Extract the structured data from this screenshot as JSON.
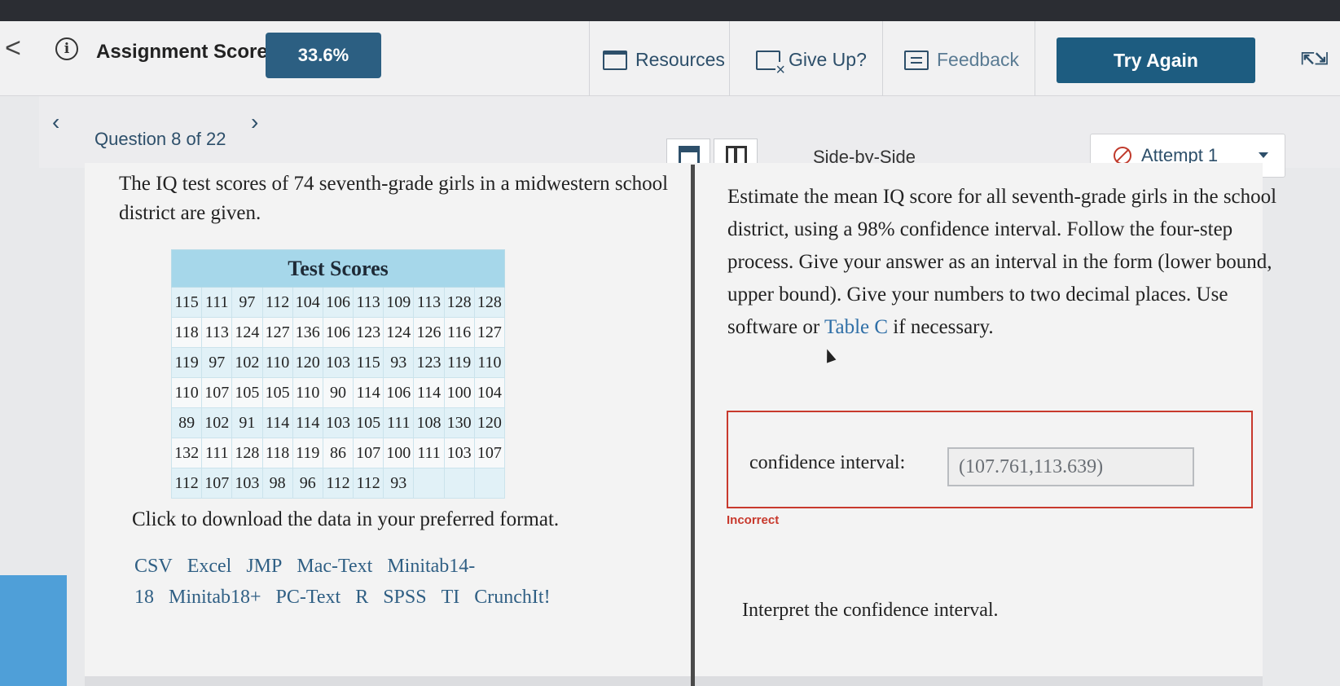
{
  "topbar": {
    "back": "<",
    "score_label": "Assignment Score:",
    "score_value": "33.6%",
    "resources": "Resources",
    "give_up": "Give Up?",
    "feedback": "Feedback",
    "try_again": "Try Again"
  },
  "subbar": {
    "question_label": "Question 8 of 22",
    "layout_label": "Side-by-Side",
    "attempt": "Attempt 1"
  },
  "left": {
    "prompt": "The IQ test scores of 74 seventh-grade girls in a midwestern school district are given.",
    "table_title": "Test Scores",
    "rows": [
      [
        "115",
        "111",
        "97",
        "112",
        "104",
        "106",
        "113",
        "109",
        "113",
        "128",
        "128"
      ],
      [
        "118",
        "113",
        "124",
        "127",
        "136",
        "106",
        "123",
        "124",
        "126",
        "116",
        "127"
      ],
      [
        "119",
        "97",
        "102",
        "110",
        "120",
        "103",
        "115",
        "93",
        "123",
        "119",
        "110"
      ],
      [
        "110",
        "107",
        "105",
        "105",
        "110",
        "90",
        "114",
        "106",
        "114",
        "100",
        "104"
      ],
      [
        "89",
        "102",
        "91",
        "114",
        "114",
        "103",
        "105",
        "111",
        "108",
        "130",
        "120"
      ],
      [
        "132",
        "111",
        "128",
        "118",
        "119",
        "86",
        "107",
        "100",
        "111",
        "103",
        "107"
      ],
      [
        "112",
        "107",
        "103",
        "98",
        "96",
        "112",
        "112",
        "93",
        "",
        "",
        ""
      ]
    ],
    "download_label": "Click to download the data in your preferred format.",
    "formats": [
      "CSV",
      "Excel",
      "JMP",
      "Mac-Text",
      "Minitab14-18",
      "Minitab18+",
      "PC-Text",
      "R",
      "SPSS",
      "TI",
      "CrunchIt!"
    ]
  },
  "right": {
    "prompt_a": "Estimate the mean IQ score for all seventh-grade girls in the school district, using a 98% confidence interval. Follow the four-step process. Give your answer as an interval in the form (lower bound, upper bound). Give your numbers to two decimal places. Use software or ",
    "table_link": "Table C",
    "prompt_b": " if necessary.",
    "ci_label": "confidence interval:",
    "ci_value": "(107.761,113.639)",
    "status": "Incorrect",
    "interpret": "Interpret the confidence interval."
  }
}
